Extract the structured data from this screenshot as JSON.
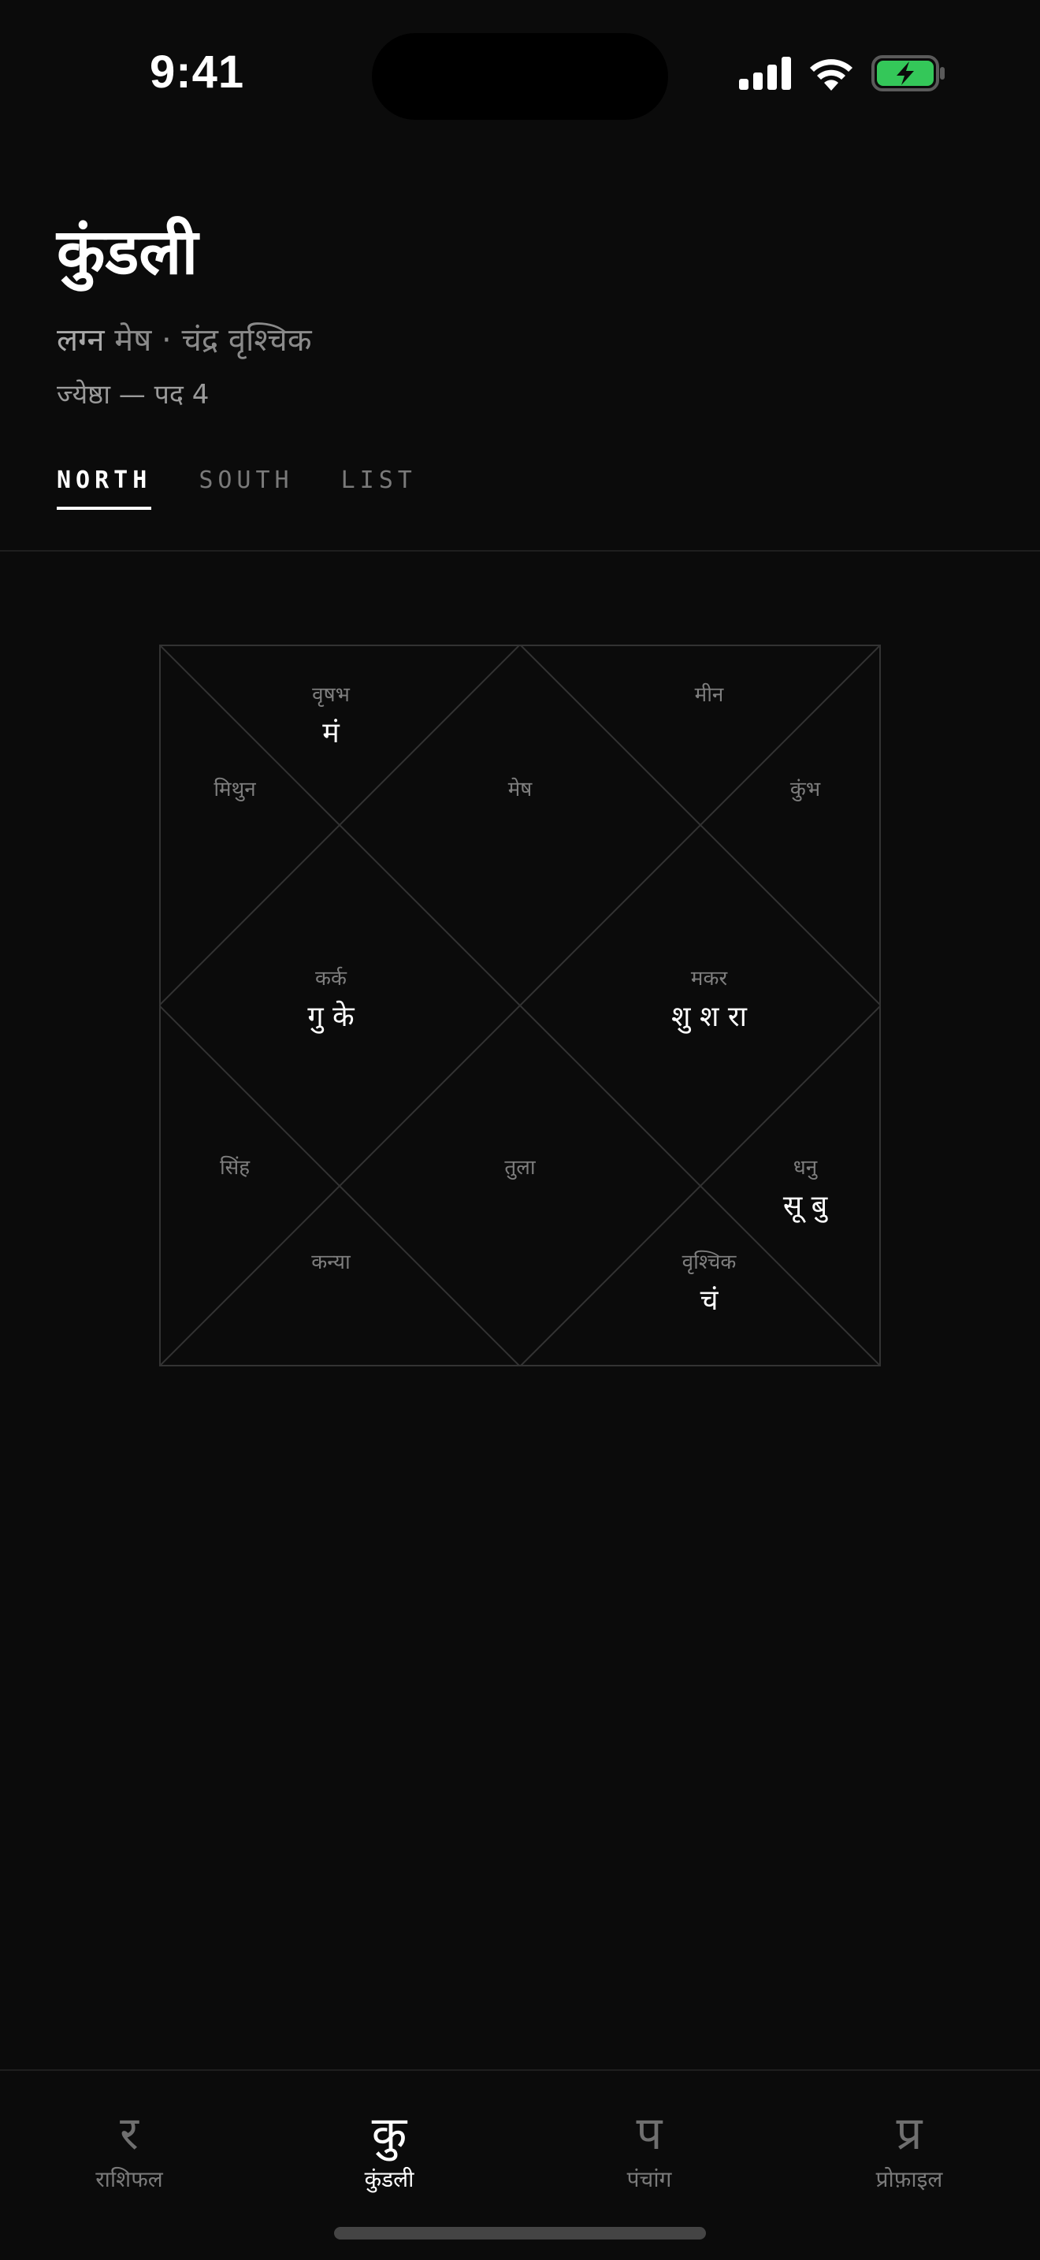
{
  "status_bar": {
    "time": "9:41"
  },
  "header": {
    "title": "कुंडली",
    "lagna_label": "लग्न",
    "lagna_rest": " मेष · चंद्र वृश्चिक",
    "nakshatra": "ज्येष्ठा — पद 4"
  },
  "tabs": [
    {
      "label": "NORTH",
      "active": true
    },
    {
      "label": "SOUTH",
      "active": false
    },
    {
      "label": "LIST",
      "active": false
    }
  ],
  "chart": {
    "houses": [
      {
        "sign": "मेष",
        "planets": ""
      },
      {
        "sign": "वृषभ",
        "planets": "मं"
      },
      {
        "sign": "मिथुन",
        "planets": ""
      },
      {
        "sign": "कर्क",
        "planets": "गु के"
      },
      {
        "sign": "सिंह",
        "planets": ""
      },
      {
        "sign": "कन्या",
        "planets": ""
      },
      {
        "sign": "तुला",
        "planets": ""
      },
      {
        "sign": "वृश्चिक",
        "planets": "चं"
      },
      {
        "sign": "धनु",
        "planets": "सू बु"
      },
      {
        "sign": "मकर",
        "planets": "शु श रा"
      },
      {
        "sign": "कुंभ",
        "planets": ""
      },
      {
        "sign": "मीन",
        "planets": ""
      }
    ]
  },
  "nav": [
    {
      "glyph": "र",
      "label": "राशिफल",
      "active": false
    },
    {
      "glyph": "कु",
      "label": "कुंडली",
      "active": true
    },
    {
      "glyph": "प",
      "label": "पंचांग",
      "active": false
    },
    {
      "glyph": "प्र",
      "label": "प्रोफ़ाइल",
      "active": false
    }
  ],
  "colors": {
    "background": "#0b0b0b",
    "line": "#333333",
    "sign_text": "#7e7e7e",
    "planet_text": "#ffffff",
    "battery": "#34c759"
  }
}
